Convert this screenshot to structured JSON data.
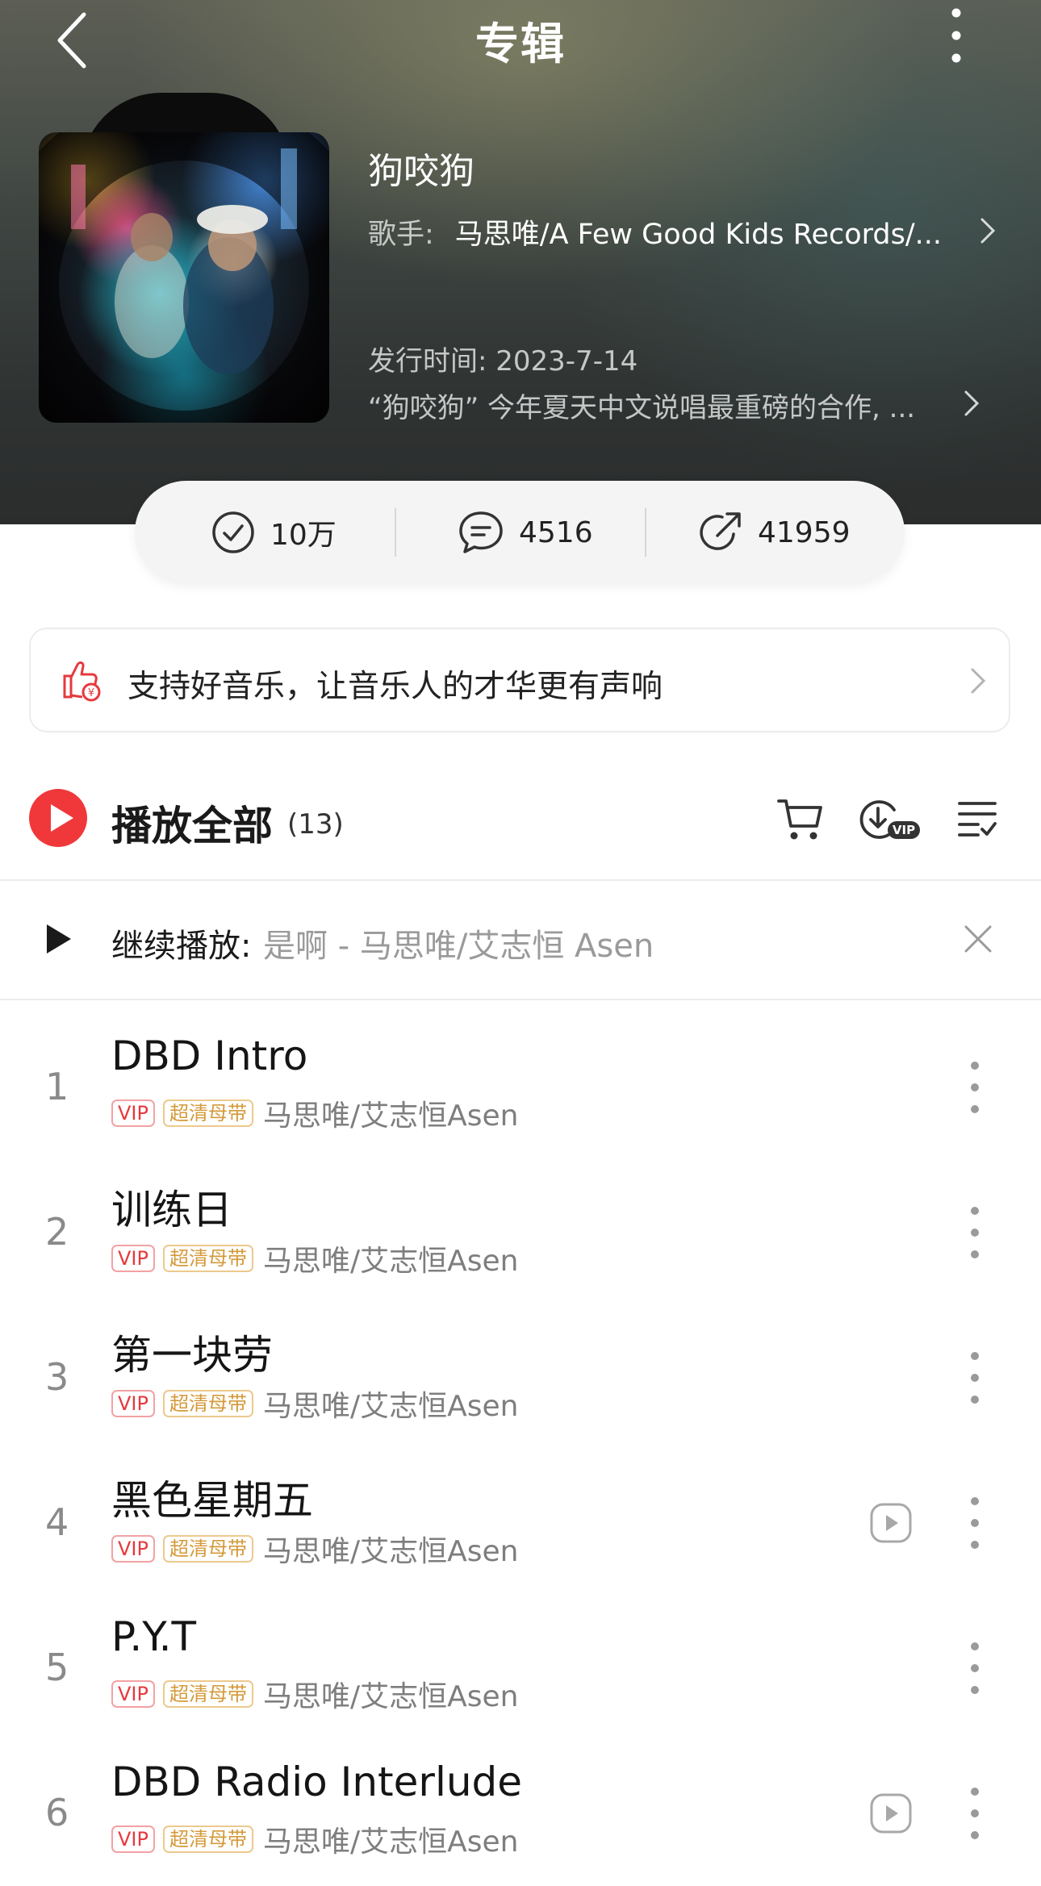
{
  "nav": {
    "title": "专辑"
  },
  "album": {
    "name": "狗咬狗",
    "artist_label": "歌手:",
    "artists": "马思唯/A Few Good Kids Records/...",
    "release": "发行时间: 2023-7-14",
    "description": "“狗咬狗” 今年夏天中文说唱最重磅的合作, ..."
  },
  "stats": {
    "collect": "10万",
    "comments": "4516",
    "shares": "41959"
  },
  "support": {
    "text": "支持好音乐，让音乐人的才华更有声响"
  },
  "playall": {
    "label": "播放全部",
    "count": "(13)"
  },
  "continue": {
    "label": "继续播放:",
    "song": "是啊 - 马思唯/艾志恒 Asen"
  },
  "tags": {
    "vip": "VIP",
    "hq": "超清母带"
  },
  "songs": [
    {
      "index": "1",
      "title": "DBD Intro",
      "artist": "马思唯/艾志恒Asen",
      "mv": false
    },
    {
      "index": "2",
      "title": "训练日",
      "artist": "马思唯/艾志恒Asen",
      "mv": false
    },
    {
      "index": "3",
      "title": "第一块劳",
      "artist": "马思唯/艾志恒Asen",
      "mv": false
    },
    {
      "index": "4",
      "title": "黑色星期五",
      "artist": "马思唯/艾志恒Asen",
      "mv": true
    },
    {
      "index": "5",
      "title": "P.Y.T",
      "artist": "马思唯/艾志恒Asen",
      "mv": false
    },
    {
      "index": "6",
      "title": "DBD Radio Interlude",
      "artist": "马思唯/艾志恒Asen",
      "mv": true
    }
  ],
  "colors": {
    "accent": "#f0383a",
    "header_bg": "#3f4642",
    "vip": "#e6393d",
    "hq": "#d49a3a"
  },
  "icons": [
    "back-icon",
    "more-vertical-icon",
    "check-circle-icon",
    "comment-icon",
    "share-icon",
    "thumbs-up-coin-icon",
    "chevron-right-icon",
    "play-icon",
    "cart-icon",
    "download-vip-icon",
    "multi-select-icon",
    "close-icon",
    "mv-play-icon"
  ]
}
